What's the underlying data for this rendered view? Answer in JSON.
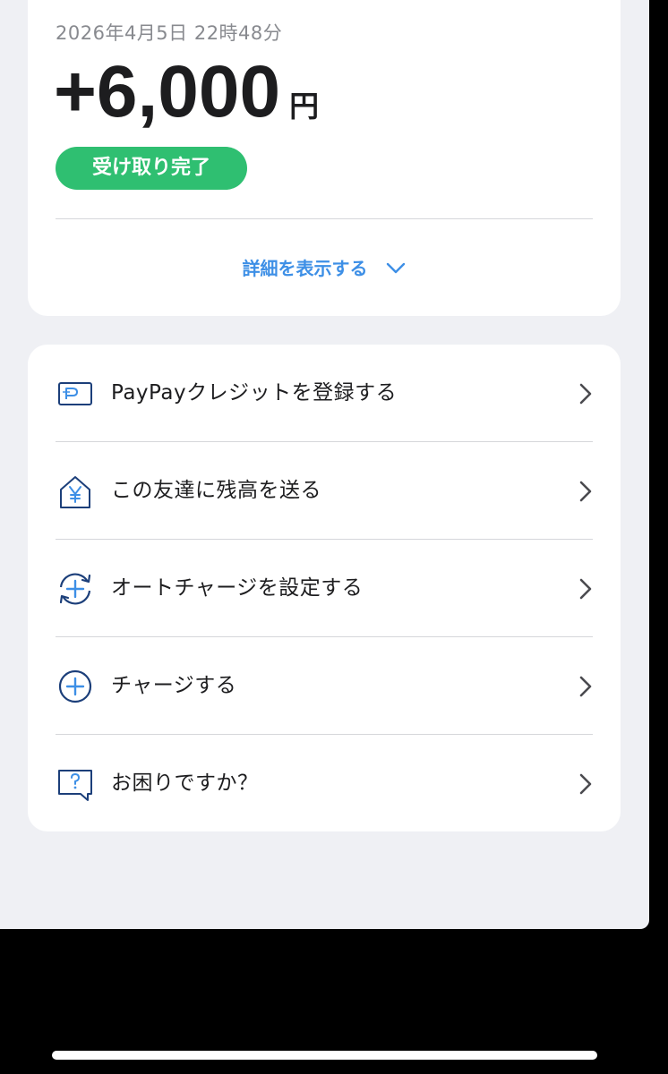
{
  "transaction": {
    "timestamp": "2026年4月5日 22時48分",
    "amount": "+6,000",
    "currency_unit": "円",
    "status": "受け取り完了",
    "details_toggle": "詳細を表示する"
  },
  "menu": {
    "items": [
      {
        "label": "PayPayクレジットを登録する",
        "icon": "paypay-card-icon"
      },
      {
        "label": "この友達に残高を送る",
        "icon": "send-balance-house-icon"
      },
      {
        "label": "オートチャージを設定する",
        "icon": "auto-charge-icon"
      },
      {
        "label": "チャージする",
        "icon": "charge-plus-icon"
      },
      {
        "label": "お困りですか？",
        "icon": "help-question-icon"
      }
    ]
  },
  "colors": {
    "accent_blue": "#3d8fe6",
    "icon_navy": "#1c3f7a",
    "status_green": "#2fbf71",
    "background": "#eff0f4"
  }
}
